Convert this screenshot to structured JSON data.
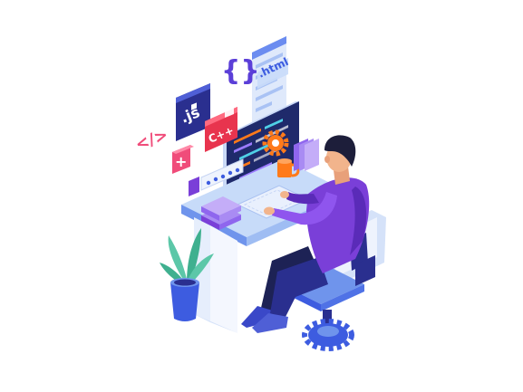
{
  "labels": {
    "braces": "{}",
    "html": ".html",
    "js": ".js",
    "cpp": "C++",
    "code_tag": "</>",
    "plus": "+"
  },
  "colors": {
    "background": "#ffffff",
    "primary_purple": "#7a3fd8",
    "deep_blue": "#2a2f8f",
    "royal_blue": "#3d5ce0",
    "light_blue": "#9fc3f7",
    "pale_blue": "#dce8fb",
    "accent_red": "#e8344e",
    "accent_pink": "#f04c7a",
    "accent_orange": "#ff7a1a",
    "plant_green": "#5cc7a8",
    "skin": "#f2b48c",
    "hair": "#1d1e3a"
  },
  "icons": [
    "curly-braces-icon",
    "html-file-icon",
    "js-file-icon",
    "cpp-file-icon",
    "code-tag-icon",
    "plus-icon",
    "gear-icon",
    "lock-icon",
    "password-dots-icon"
  ]
}
